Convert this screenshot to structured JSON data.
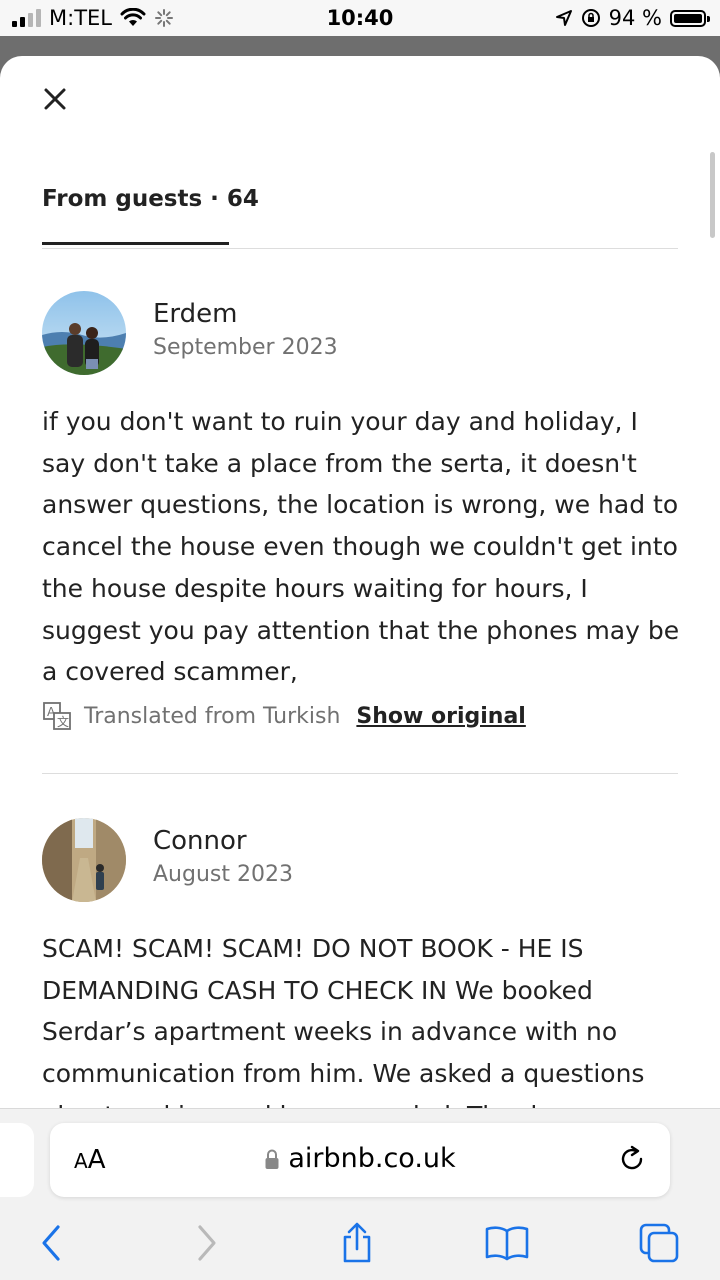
{
  "status_bar": {
    "carrier": "M:TEL",
    "time": "10:40",
    "battery": "94 %"
  },
  "sheet": {
    "tab_label": "From guests · 64"
  },
  "reviews": [
    {
      "name": "Erdem",
      "date": "September 2023",
      "text": "if you don't want to ruin your day and holiday, I say don't take a place from the serta, it doesn't answer questions, the location is wrong, we had to cancel the house even though we couldn't get into the house despite hours waiting for hours, I suggest you pay attention that the phones may be a covered scammer,",
      "translated_note": "Translated from Turkish",
      "show_original": "Show original"
    },
    {
      "name": "Connor",
      "date": "August 2023",
      "text": "SCAM! SCAM! SCAM! DO NOT BOOK - HE IS DEMANDING CASH TO CHECK IN We booked Serdar’s apartment weeks in advance with no communication from him. We asked a questions about parking and he responded. The day"
    }
  ],
  "browser": {
    "text_size_label_big": "A",
    "text_size_label_small": "A",
    "url": "airbnb.co.uk"
  },
  "icons": {
    "close": "close-icon",
    "translate": "translate-icon",
    "lock": "lock-icon",
    "reload": "reload-icon",
    "back": "chevron-left-icon",
    "forward": "chevron-right-icon",
    "share": "share-icon",
    "bookmarks": "book-icon",
    "tabs": "tabs-icon"
  },
  "colors": {
    "accent_blue": "#1a73e8",
    "text": "#222222",
    "muted": "#717171"
  }
}
